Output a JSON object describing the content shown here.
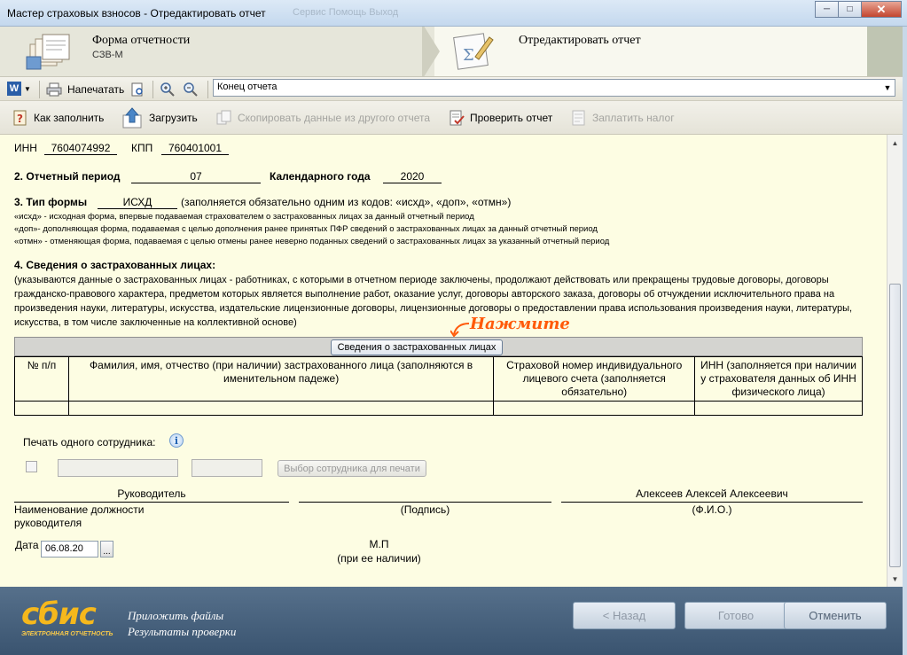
{
  "window": {
    "title": "Мастер страховых взносов - Отредактировать отчет",
    "ghost_menu": "Сервис        Помощь      Выход",
    "minimize": "─",
    "maximize": "□",
    "close": "✕"
  },
  "header": {
    "step1_title": "Форма отчетности",
    "step1_sub": "СЗВ-М",
    "step2_title": "Отредактировать отчет"
  },
  "toolbar1": {
    "print_label": "Напечатать",
    "section_combo": "Конец отчета"
  },
  "toolbar2": {
    "how_to_fill": "Как заполнить",
    "load": "Загрузить",
    "copy_data": "Скопировать данные из другого отчета",
    "check_report": "Проверить отчет",
    "pay_tax": "Заплатить налог"
  },
  "form": {
    "inn_label": "ИНН",
    "inn_value": "7604074992",
    "kpp_label": "КПП",
    "kpp_value": "760401001",
    "period_label": "2. Отчетный период",
    "period_value": "07",
    "year_label": "Календарного года",
    "year_value": "2020",
    "form_type_label": "3. Тип формы",
    "form_type_value": "ИСХД",
    "form_type_note": "(заполняется обязательно одним из кодов: «исхд», «доп», «отмн»)",
    "code_ishd": "«исхд» - исходная форма, впервые подаваемая страхователем о застрахованных лицах за данный отчетный период",
    "code_dop": "«доп»- дополняющая форма, подаваемая с целью дополнения ранее принятых ПФР сведений о застрахованных лицах за данный отчетный период",
    "code_otmn": "«отмн» - отменяющая форма, подаваемая с целью отмены ранее неверно поданных сведений о застрахованных лицах за указанный отчетный период",
    "section4_title": "4. Сведения о застрахованных лицах:",
    "section4_text": "(указываются данные о застрахованных лицах - работниках, с которыми в отчетном периоде заключены, продолжают действовать или прекращены трудовые договоры, договоры гражданско-правового характера, предметом которых является выполнение работ, оказание услуг, договоры авторского заказа, договоры об отчуждении исключительного права на произведения науки, литературы, искусства, издательские лицензионные договоры, лицензионные договоры о предоставлении права использования произведения науки, литературы, искусства, в том числе заключенные на коллективной основе)",
    "annotation": "Нажмите",
    "insured_button": "Сведения о застрахованных лицах",
    "columns": [
      "№ п/п",
      "Фамилия, имя, отчество (при наличии) застрахованного лица (заполняются в именительном падеже)",
      "Страховой номер индивидуального лицевого счета (заполняется обязательно)",
      "ИНН (заполняется при наличии у страхователя данных об ИНН физического лица)"
    ],
    "print_one_label": "Печать одного сотрудника:",
    "select_employee_button": "Выбор сотрудника для печати",
    "head_position": "Руководитель",
    "head_position_caption": "Наименование должности руководителя",
    "signature_caption": "(Подпись)",
    "head_name": "Алексеев Алексей Алексеевич",
    "head_name_caption": "(Ф.И.О.)",
    "date_label": "Дата",
    "date_value": "06.08.20",
    "date_button": "...",
    "stamp": "М.П",
    "stamp_caption": "(при ее наличии)"
  },
  "footer": {
    "logo": "сбис",
    "logo_tagline": "ЭЛЕКТРОННАЯ ОТЧЕТНОСТЬ",
    "attach_files": "Приложить файлы",
    "check_results": "Результаты проверки",
    "back": "< Назад",
    "done": "Готово",
    "cancel": "Отменить"
  }
}
